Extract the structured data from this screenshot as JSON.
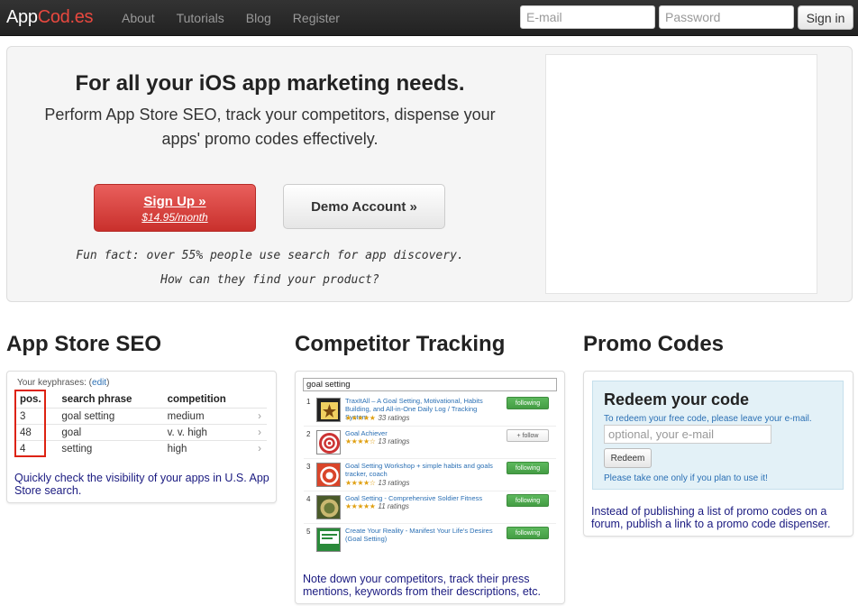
{
  "navbar": {
    "brand_main": "App",
    "brand_accent": "Cod.es",
    "links": [
      "About",
      "Tutorials",
      "Blog",
      "Register"
    ],
    "email_placeholder": "E-mail",
    "password_placeholder": "Password",
    "signin_label": "Sign in"
  },
  "hero": {
    "title": "For all your iOS app marketing needs.",
    "subtitle": "Perform App Store SEO, track your competitors, dispense your apps' promo codes effectively.",
    "signup_label": "Sign Up »",
    "signup_price": "$14.95/month",
    "demo_label": "Demo Account »",
    "fun_fact_line1": "Fun fact: over 55% people use search for app discovery.",
    "fun_fact_line2": "How can they find your product?"
  },
  "seo": {
    "heading": "App Store SEO",
    "keyphrases_label": "Your keyphrases: (",
    "edit_link": "edit",
    "keyphrases_close": ")",
    "columns": [
      "pos.",
      "search phrase",
      "competition"
    ],
    "rows": [
      {
        "pos": "3",
        "phrase": "goal setting",
        "competition": "medium"
      },
      {
        "pos": "48",
        "phrase": "goal",
        "competition": "v. v. high"
      },
      {
        "pos": "4",
        "phrase": "setting",
        "competition": "high"
      }
    ],
    "description": "Quickly check the visibility of your apps in U.S. App Store search."
  },
  "competitors": {
    "heading": "Competitor Tracking",
    "search_value": "goal setting",
    "items": [
      {
        "num": "1",
        "title": "TraxItAll – A Goal Setting, Motivational, Habits Building, and All-in-One Daily Log / Tracking System",
        "ratings": "33 ratings",
        "follow": "following",
        "following": true
      },
      {
        "num": "2",
        "title": "Goal Achiever",
        "ratings": "13 ratings",
        "follow": "+ follow",
        "following": false
      },
      {
        "num": "3",
        "title": "Goal Setting Workshop + simple habits and goals tracker, coach",
        "ratings": "13 ratings",
        "follow": "following",
        "following": true
      },
      {
        "num": "4",
        "title": "Goal Setting - Comprehensive Soldier Fitness",
        "ratings": "11 ratings",
        "follow": "following",
        "following": true
      },
      {
        "num": "5",
        "title": "Create Your Reality - Manifest Your Life's Desires (Goal Setting)",
        "ratings": "",
        "follow": "following",
        "following": true
      }
    ],
    "description": "Note down your competitors, track their press mentions, keywords from their descriptions, etc."
  },
  "promo": {
    "heading": "Promo Codes",
    "redeem_title": "Redeem your code",
    "redeem_sub": "To redeem your free code, please leave your e-mail.",
    "input_placeholder": "optional, your e-mail",
    "redeem_button": "Redeem",
    "note": "Please take one only if you plan to use it!",
    "description": "Instead of publishing a list of promo codes on a forum, publish a link to a promo code dispenser."
  },
  "colors": {
    "navbar": "#222222",
    "brand_accent": "#e8483f",
    "signup": "#c9302c",
    "following": "#5cb85c",
    "link": "#2a6fb4",
    "highlight_box": "#dd1111"
  }
}
